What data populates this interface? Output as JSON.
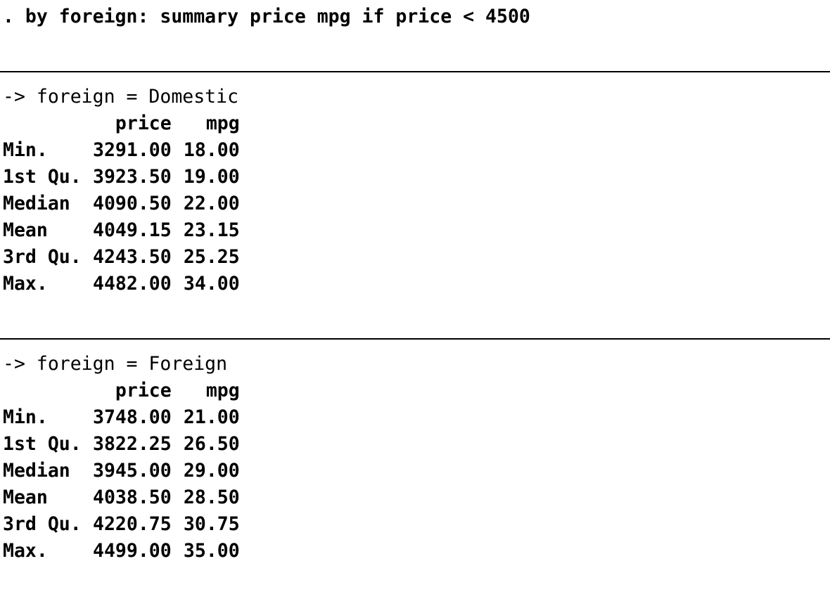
{
  "command": ". by foreign: summary price mpg if price < 4500",
  "columns": {
    "price": "price",
    "mpg": "mpg"
  },
  "groups": [
    {
      "header": "-> foreign = Domestic",
      "rows": [
        {
          "stat": "Min.",
          "price": "3291.00",
          "mpg": "18.00"
        },
        {
          "stat": "1st Qu.",
          "price": "3923.50",
          "mpg": "19.00"
        },
        {
          "stat": "Median",
          "price": "4090.50",
          "mpg": "22.00"
        },
        {
          "stat": "Mean",
          "price": "4049.15",
          "mpg": "23.15"
        },
        {
          "stat": "3rd Qu.",
          "price": "4243.50",
          "mpg": "25.25"
        },
        {
          "stat": "Max.",
          "price": "4482.00",
          "mpg": "34.00"
        }
      ]
    },
    {
      "header": "-> foreign = Foreign",
      "rows": [
        {
          "stat": "Min.",
          "price": "3748.00",
          "mpg": "21.00"
        },
        {
          "stat": "1st Qu.",
          "price": "3822.25",
          "mpg": "26.50"
        },
        {
          "stat": "Median",
          "price": "3945.00",
          "mpg": "29.00"
        },
        {
          "stat": "Mean",
          "price": "4038.50",
          "mpg": "28.50"
        },
        {
          "stat": "3rd Qu.",
          "price": "4220.75",
          "mpg": "30.75"
        },
        {
          "stat": "Max.",
          "price": "4499.00",
          "mpg": "35.00"
        }
      ]
    }
  ]
}
